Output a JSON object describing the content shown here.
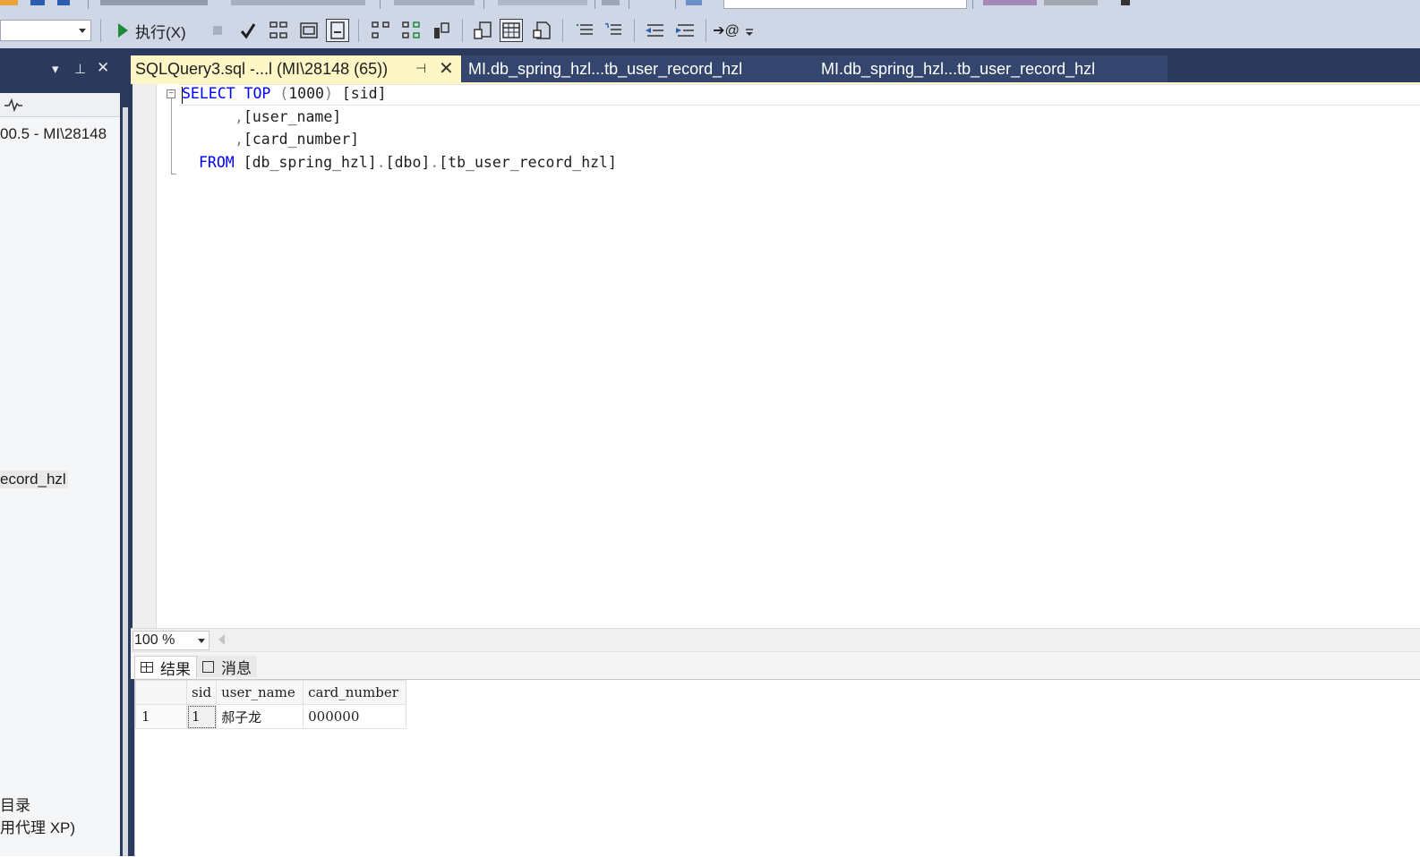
{
  "toolbar": {
    "execute_label": "执行(X)",
    "icons": [
      "play-icon",
      "stop-icon",
      "check-icon",
      "display-plan-icon",
      "query-design-icon",
      "results-to-grid-icon",
      "include-stats-icon",
      "indent-icon",
      "comment-icon",
      "specify-values-icon"
    ]
  },
  "left_panel": {
    "server_text": "00.5 - MI\\28148",
    "table_text": "ecord_hzl",
    "item3_text": "目录",
    "item4_text": "用代理 XP)"
  },
  "tabs": [
    {
      "label": "SQLQuery3.sql -...l (MI\\28148 (65))",
      "active": true
    },
    {
      "label": "MI.db_spring_hzl...tb_user_record_hzl",
      "active": false
    },
    {
      "label": "MI.db_spring_hzl...tb_user_record_hzl",
      "active": false
    }
  ],
  "editor": {
    "line1": {
      "kw1": "SELECT",
      "kw2": "TOP",
      "paren_open": "(",
      "num": "1000",
      "paren_close": ")",
      "col": "[sid]"
    },
    "line2": {
      "comma": ",",
      "col": "[user_name]"
    },
    "line3": {
      "comma": ",",
      "col": "[card_number]"
    },
    "line4": {
      "kw": "FROM",
      "db": "[db_spring_hzl]",
      "dot1": ".",
      "schema": "[dbo]",
      "dot2": ".",
      "table": "[tb_user_record_hzl]"
    }
  },
  "zoom": {
    "value": "100 %"
  },
  "result_tabs": {
    "results": "结果",
    "messages": "消息"
  },
  "grid": {
    "columns": [
      "sid",
      "user_name",
      "card_number"
    ],
    "rows": [
      {
        "row_num": "1",
        "sid": "1",
        "user_name": "郝子龙",
        "card_number": "000000"
      }
    ]
  },
  "colors": {
    "frame": "#2b3a5c",
    "active_tab": "#fff6c6",
    "keyword": "#0000ff"
  }
}
